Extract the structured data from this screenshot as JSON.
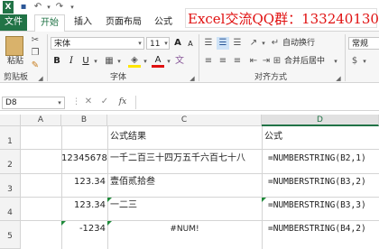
{
  "quick_access": {
    "undo": "↶",
    "redo": "↷",
    "customize": "▾"
  },
  "banner": "Excel交流QQ群：133240130",
  "tabs": [
    "文件",
    "开始",
    "插入",
    "页面布局",
    "公式"
  ],
  "ribbon": {
    "paste_label": "粘贴",
    "font_name": "宋体",
    "font_size": "11",
    "bold": "B",
    "italic": "I",
    "underline": "U",
    "wrap_text": "自动换行",
    "merge_center": "合并后居中",
    "number_format": "常规",
    "font_color_glyph": "A",
    "increase_font": "A",
    "decrease_font": "A",
    "groups": {
      "clipboard": "剪贴板",
      "font": "字体",
      "alignment": "对齐方式"
    }
  },
  "formula_bar": {
    "name_box": "D8",
    "cancel": "✕",
    "enter": "✓",
    "fx": "fx",
    "content": ""
  },
  "columns": [
    "A",
    "B",
    "C",
    "D"
  ],
  "rows": [
    "1",
    "2",
    "3",
    "4",
    "5"
  ],
  "cells": {
    "c1": "公式结果",
    "d1": "公式",
    "b2": "12345678",
    "c2": "一千二百三十四万五千六百七十八",
    "d2": "=NUMBERSTRING(B2,1)",
    "b3": "123.34",
    "c3": "壹佰贰拾叁",
    "d3": "=NUMBERSTRING(B3,2)",
    "b4": "123.34",
    "c4": "一二三",
    "d4": "=NUMBERSTRING(B3,3)",
    "b5": "-1234",
    "c5": "#NUM!",
    "d5": "=NUMBERSTRING(B4,2)"
  }
}
